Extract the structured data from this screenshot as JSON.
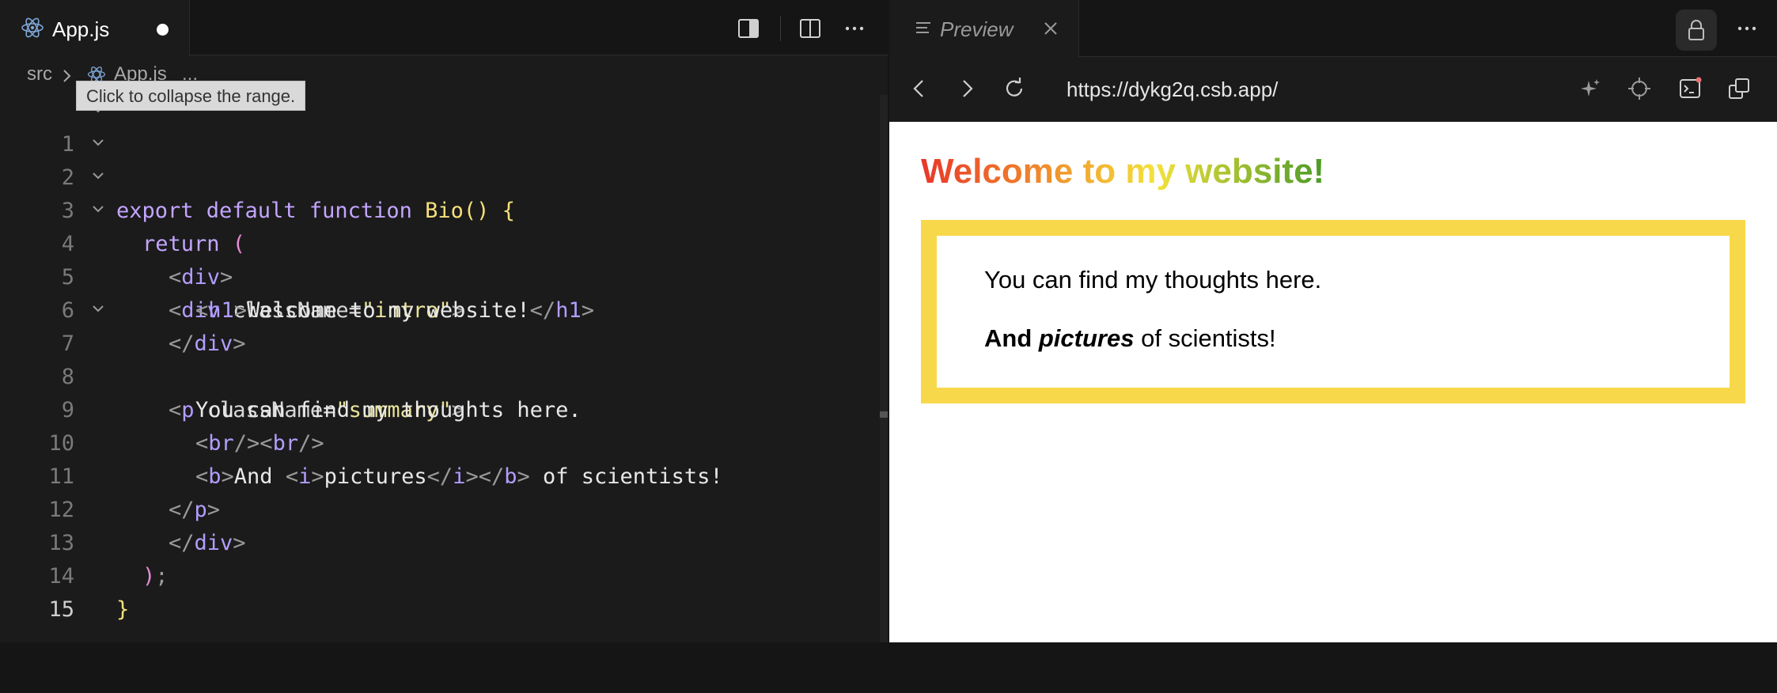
{
  "editor": {
    "tab_label": "App.js",
    "breadcrumb": {
      "folder": "src",
      "file": "App.js",
      "more": "..."
    },
    "tooltip": "Click to collapse the range.",
    "lines": [
      {
        "n": "1",
        "text": "export default function Bio() {"
      },
      {
        "n": "2",
        "text": "return ("
      },
      {
        "n": "3",
        "text": "<div>"
      },
      {
        "n": "4",
        "text": "<div className=\"intro\">"
      },
      {
        "n": "5",
        "text": "<h1>Welcome to my website!</h1>"
      },
      {
        "n": "6",
        "text": "</div>"
      },
      {
        "n": "7",
        "text": "<p className=\"summary\">"
      },
      {
        "n": "8",
        "text": "You can find my thoughts here."
      },
      {
        "n": "9",
        "text": "<br/><br/>"
      },
      {
        "n": "10",
        "text": "<b>And <i>pictures</i></b> of scientists!"
      },
      {
        "n": "11",
        "text": "</p>"
      },
      {
        "n": "12",
        "text": "</div>"
      },
      {
        "n": "13",
        "text": ");"
      },
      {
        "n": "14",
        "text": "}"
      },
      {
        "n": "15",
        "text": ""
      }
    ]
  },
  "preview": {
    "tab_label": "Preview",
    "url": "https://dykg2q.csb.app/",
    "heading": "Welcome to my website!",
    "summary_line1": "You can find my thoughts here.",
    "summary_bold": "And ",
    "summary_italic": "pictures",
    "summary_rest": " of scientists!"
  },
  "icons": [
    "react-icon",
    "unsaved-dot-icon",
    "toggle-sidebar-icon",
    "split-editor-icon",
    "more-icon",
    "preview-list-icon",
    "close-icon",
    "lock-icon",
    "back-icon",
    "forward-icon",
    "reload-icon",
    "sparkle-icon",
    "crosshair-icon",
    "terminal-icon",
    "open-external-icon",
    "chevron-down-icon"
  ],
  "colors": {
    "accent_yellow": "#f7d84a",
    "keyword": "#c3a5ff",
    "function": "#f5e07a",
    "string": "#e9e39a"
  }
}
